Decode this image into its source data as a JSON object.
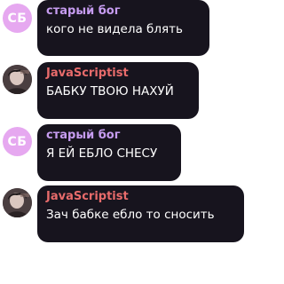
{
  "messages": [
    {
      "sender": "старый бог",
      "sender_color": "#c69cf0",
      "avatar_initials": "СБ",
      "text": "кого не видела блять"
    },
    {
      "sender": "JavaScriptist",
      "sender_color": "#e86b6b",
      "avatar_initials": "",
      "text": "БАБКУ ТВОЮ НАХУЙ"
    },
    {
      "sender": "старый бог",
      "sender_color": "#c69cf0",
      "avatar_initials": "СБ",
      "text": "Я ЕЙ ЕБЛО СНЕСУ"
    },
    {
      "sender": "JavaScriptist",
      "sender_color": "#e86b6b",
      "avatar_initials": "",
      "text": "Зач бабке ебло то сносить"
    }
  ]
}
